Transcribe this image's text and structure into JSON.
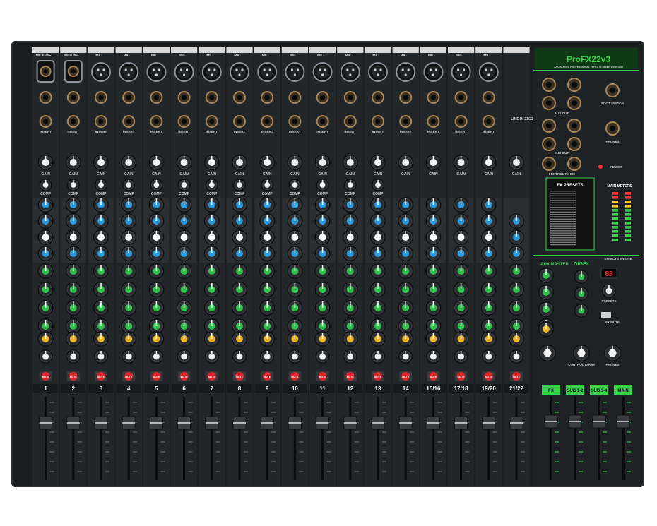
{
  "brand": {
    "model": "ProFX22v3",
    "subtitle": "22-CHANNEL PROFESSIONAL EFFECTS MIXER WITH USB"
  },
  "channels": [
    {
      "top": "MIC/LINE",
      "num": "1"
    },
    {
      "top": "MIC/LINE",
      "num": "2"
    },
    {
      "top": "MIC",
      "num": "3"
    },
    {
      "top": "MIC",
      "num": "4"
    },
    {
      "top": "MIC",
      "num": "5"
    },
    {
      "top": "MIC",
      "num": "6"
    },
    {
      "top": "MIC",
      "num": "7"
    },
    {
      "top": "MIC",
      "num": "8"
    },
    {
      "top": "MIC",
      "num": "9"
    },
    {
      "top": "MIC",
      "num": "10"
    },
    {
      "top": "MIC",
      "num": "11"
    },
    {
      "top": "MIC",
      "num": "12"
    },
    {
      "top": "MIC",
      "num": "13"
    },
    {
      "top": "MIC",
      "num": "14"
    },
    {
      "top": "MIC",
      "num": "15/16"
    },
    {
      "top": "MIC",
      "num": "17/18"
    },
    {
      "top": "MIC",
      "num": "19/20"
    },
    {
      "top": "",
      "num": "21/22"
    }
  ],
  "labels": {
    "line_in_2122": "LINE IN 21/22",
    "gain": "GAIN",
    "comp": "COMP",
    "mute": "MUTE",
    "insert": "INSERT",
    "aux_out": "AUX OUT",
    "sub_out": "SUB OUT",
    "control_room": "CONTROL ROOM",
    "foot_switch": "FOOT SWITCH",
    "phones": "PHONES",
    "power": "POWER",
    "fx_presets": "FX PRESETS",
    "main_meters": "MAIN METERS",
    "aux_master": "AUX MASTER",
    "gigfx": "GIGFX",
    "effects_engine": "EFFECTS ENGINE",
    "fx_display": "88",
    "fx_mute": "FX MUTE",
    "presets": "PRESETS",
    "control_room_knob": "CONTROL ROOM",
    "phones_knob": "PHONES"
  },
  "master_faders": [
    "FX",
    "SUB 1-2",
    "SUB 3-4",
    "MAIN"
  ],
  "colors": {
    "panel": "#1b1d1f",
    "accent_green": "#38d14a",
    "knob_blue": "#2a9be0",
    "knob_green": "#2ec24a",
    "knob_yellow": "#f2b21b",
    "mute_red": "#d8262b"
  }
}
